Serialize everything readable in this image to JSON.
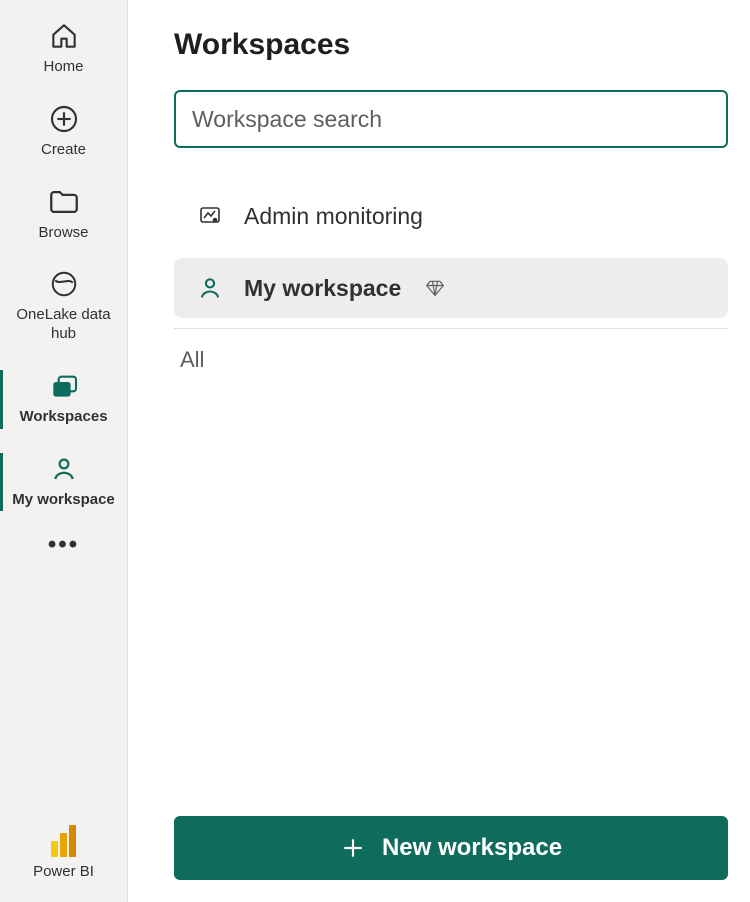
{
  "sidebar": {
    "items": [
      {
        "label": "Home"
      },
      {
        "label": "Create"
      },
      {
        "label": "Browse"
      },
      {
        "label": "OneLake data hub"
      },
      {
        "label": "Workspaces"
      },
      {
        "label": "My workspace"
      }
    ],
    "footer_label": "Power BI"
  },
  "main": {
    "title": "Workspaces",
    "search_placeholder": "Workspace search",
    "rows": [
      {
        "label": "Admin monitoring"
      },
      {
        "label": "My workspace"
      }
    ],
    "section_label": "All",
    "new_button_label": "New workspace"
  },
  "colors": {
    "accent": "#0f6b5c"
  }
}
